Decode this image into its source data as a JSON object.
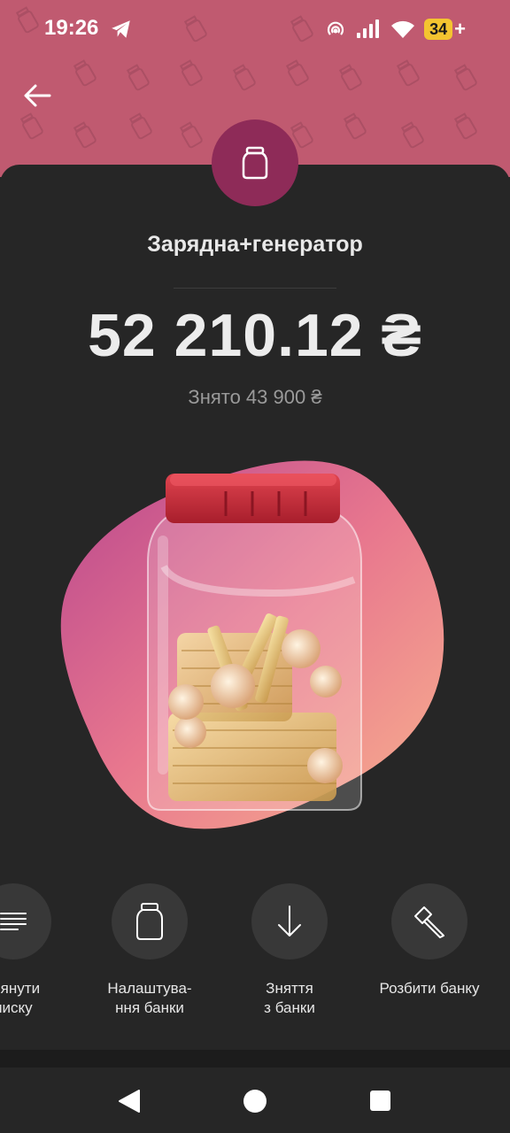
{
  "status_bar": {
    "time": "19:26",
    "battery_level": "34",
    "battery_charging_mark": "+",
    "icons": [
      "telegram-icon",
      "hotspot-icon",
      "signal-icon",
      "wifi-icon",
      "battery-icon"
    ]
  },
  "header": {
    "back_icon": "arrow-left-icon",
    "background_color": "#c05a70",
    "badge_color": "#8e2b58"
  },
  "jar": {
    "name": "Зарядна+генератор",
    "balance": "52 210.12 ₴",
    "withdrawn": "Знято 43 900 ₴"
  },
  "actions": [
    {
      "label": "глянути\nписку",
      "icon": "list-icon"
    },
    {
      "label": "Налаштува-\nння банки",
      "icon": "jar-icon"
    },
    {
      "label": "Зняття\nз банки",
      "icon": "arrow-down-icon"
    },
    {
      "label": "Розбити банку",
      "icon": "hammer-icon"
    }
  ],
  "navigation": {
    "icons": [
      "nav-back-icon",
      "nav-home-icon",
      "nav-recents-icon"
    ]
  }
}
